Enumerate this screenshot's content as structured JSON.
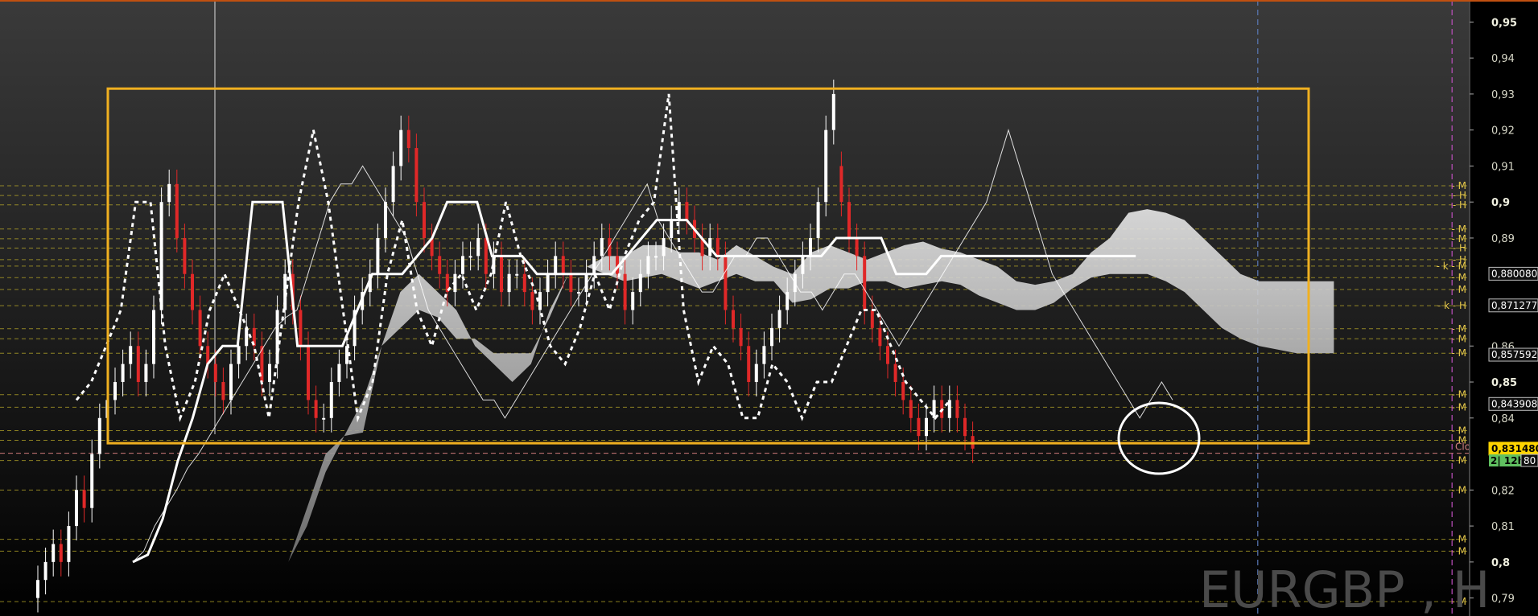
{
  "chart_data": {
    "type": "candlestick",
    "symbol_watermark": "EURGBP , H",
    "ylim": [
      0.785,
      0.955
    ],
    "y_ticks": [
      {
        "value": 0.95,
        "label": "0,95",
        "bold": true
      },
      {
        "value": 0.94,
        "label": "0,94",
        "bold": false
      },
      {
        "value": 0.93,
        "label": "0,93",
        "bold": false
      },
      {
        "value": 0.92,
        "label": "0,92",
        "bold": false
      },
      {
        "value": 0.91,
        "label": "0,91",
        "bold": false
      },
      {
        "value": 0.9,
        "label": "0,9",
        "bold": true
      },
      {
        "value": 0.89,
        "label": "0,89",
        "bold": false
      },
      {
        "value": 0.86,
        "label": "0,86",
        "bold": false
      },
      {
        "value": 0.85,
        "label": "0,85",
        "bold": true
      },
      {
        "value": 0.84,
        "label": "0,84",
        "bold": false
      },
      {
        "value": 0.82,
        "label": "0,82",
        "bold": false
      },
      {
        "value": 0.81,
        "label": "0,81",
        "bold": false
      },
      {
        "value": 0.8,
        "label": "0,8",
        "bold": true
      },
      {
        "value": 0.79,
        "label": "0,79",
        "bold": false
      }
    ],
    "price_boxes": [
      {
        "value": 0.88008,
        "label": "0,880080",
        "style": "dark"
      },
      {
        "value": 0.871277,
        "label": "0,871277",
        "style": "dark"
      },
      {
        "value": 0.857592,
        "label": "0,857592",
        "style": "dark"
      },
      {
        "value": 0.843908,
        "label": "0,843908",
        "style": "dark"
      },
      {
        "value": 0.83148,
        "label": "0,831480",
        "style": "current"
      }
    ],
    "countdown_label": "2| 12h",
    "countdown_tail": "80",
    "close_label": "Clo J",
    "level_lines": [
      {
        "value": 0.9045,
        "label": "M"
      },
      {
        "value": 0.9018,
        "label": "H"
      },
      {
        "value": 0.8992,
        "label": "H"
      },
      {
        "value": 0.8925,
        "label": "M"
      },
      {
        "value": 0.8898,
        "label": "M"
      },
      {
        "value": 0.8872,
        "label": "H"
      },
      {
        "value": 0.884,
        "label": "H"
      },
      {
        "value": 0.8822,
        "label": "k - M"
      },
      {
        "value": 0.879,
        "label": "M"
      },
      {
        "value": 0.8757,
        "label": "M"
      },
      {
        "value": 0.8712,
        "label": "k - H"
      },
      {
        "value": 0.8648,
        "label": "M"
      },
      {
        "value": 0.862,
        "label": "M"
      },
      {
        "value": 0.858,
        "label": "M"
      },
      {
        "value": 0.8465,
        "label": "M"
      },
      {
        "value": 0.843,
        "label": "M"
      },
      {
        "value": 0.8365,
        "label": "M"
      },
      {
        "value": 0.8338,
        "label": "M"
      },
      {
        "value": 0.8282,
        "label": "M"
      },
      {
        "value": 0.82,
        "label": "M"
      },
      {
        "value": 0.8063,
        "label": "M"
      },
      {
        "value": 0.803,
        "label": "M"
      },
      {
        "value": 0.789,
        "label": "M"
      }
    ],
    "range_box": {
      "top": 0.9315,
      "bottom": 0.833
    },
    "vertical_markers": [
      {
        "bar": 218,
        "color": "#5a7ab8"
      },
      {
        "bar": 252,
        "color": "#c050c0"
      },
      {
        "bar": 275,
        "color": "#c8a020"
      }
    ],
    "series": [
      {
        "name": "tenkan",
        "values": [
          0.8,
          0.803,
          0.81,
          0.815,
          0.82,
          0.826,
          0.83,
          0.835,
          0.84,
          0.845,
          0.85,
          0.855,
          0.86,
          0.865,
          0.868,
          0.87,
          0.88,
          0.89,
          0.9,
          0.905,
          0.905,
          0.91,
          0.905,
          0.9,
          0.895,
          0.89,
          0.88,
          0.87,
          0.865,
          0.86,
          0.855,
          0.85,
          0.845,
          0.845,
          0.84,
          0.845,
          0.85,
          0.855,
          0.86,
          0.865,
          0.87,
          0.875,
          0.88,
          0.885,
          0.89,
          0.895,
          0.9,
          0.905,
          0.895,
          0.89,
          0.885,
          0.88,
          0.875,
          0.875,
          0.88,
          0.885,
          0.885,
          0.89,
          0.89,
          0.885,
          0.88,
          0.875,
          0.875,
          0.87,
          0.875,
          0.88,
          0.88,
          0.875,
          0.87,
          0.865,
          0.86,
          0.865,
          0.87,
          0.875,
          0.88,
          0.885,
          0.89,
          0.895,
          0.9,
          0.91,
          0.92,
          0.91,
          0.9,
          0.89,
          0.88,
          0.875,
          0.87,
          0.865,
          0.86,
          0.855,
          0.85,
          0.845,
          0.84,
          0.845,
          0.85,
          0.845
        ]
      },
      {
        "name": "kijun",
        "values": [
          0.8,
          0.802,
          0.812,
          0.828,
          0.84,
          0.855,
          0.86,
          0.86,
          0.9,
          0.9,
          0.9,
          0.86,
          0.86,
          0.86,
          0.86,
          0.87,
          0.88,
          0.88,
          0.88,
          0.885,
          0.89,
          0.9,
          0.9,
          0.9,
          0.885,
          0.885,
          0.885,
          0.88,
          0.88,
          0.88,
          0.88,
          0.88,
          0.88,
          0.885,
          0.89,
          0.895,
          0.895,
          0.895,
          0.89,
          0.885,
          0.885,
          0.885,
          0.885,
          0.885,
          0.885,
          0.885,
          0.885,
          0.89,
          0.89,
          0.89,
          0.89,
          0.88,
          0.88,
          0.88,
          0.885,
          0.885,
          0.885,
          0.885,
          0.885,
          0.885,
          0.885,
          0.885,
          0.885,
          0.885,
          0.885,
          0.885,
          0.885,
          0.885
        ]
      },
      {
        "name": "chikou",
        "values": [
          0.845,
          0.85,
          0.86,
          0.87,
          0.9,
          0.9,
          0.86,
          0.84,
          0.85,
          0.87,
          0.88,
          0.87,
          0.86,
          0.84,
          0.87,
          0.9,
          0.92,
          0.9,
          0.87,
          0.84,
          0.85,
          0.88,
          0.895,
          0.87,
          0.86,
          0.875,
          0.88,
          0.87,
          0.88,
          0.9,
          0.885,
          0.875,
          0.86,
          0.855,
          0.865,
          0.88,
          0.87,
          0.885,
          0.895,
          0.9,
          0.93,
          0.87,
          0.85,
          0.86,
          0.855,
          0.84,
          0.84,
          0.855,
          0.85,
          0.84,
          0.85,
          0.85,
          0.86,
          0.87,
          0.87,
          0.86,
          0.85,
          0.845,
          0.84,
          0.845
        ]
      }
    ],
    "cloud": {
      "senkou_a": [
        0.79,
        0.8,
        0.81,
        0.825,
        0.835,
        0.845,
        0.86,
        0.875,
        0.88,
        0.875,
        0.87,
        0.86,
        0.855,
        0.85,
        0.855,
        0.87,
        0.88,
        0.882,
        0.885,
        0.885,
        0.888,
        0.888,
        0.886,
        0.886,
        0.884,
        0.888,
        0.885,
        0.882,
        0.88,
        0.886,
        0.888,
        0.886,
        0.884,
        0.886,
        0.888,
        0.889,
        0.887,
        0.886,
        0.884,
        0.882,
        0.878,
        0.877,
        0.878,
        0.88,
        0.886,
        0.89,
        0.897,
        0.898,
        0.897,
        0.895,
        0.89,
        0.885,
        0.88,
        0.878,
        0.878,
        0.878,
        0.878,
        0.878
      ],
      "senkou_b": [
        0.79,
        0.8,
        0.815,
        0.83,
        0.835,
        0.836,
        0.86,
        0.865,
        0.87,
        0.868,
        0.862,
        0.862,
        0.858,
        0.858,
        0.858,
        0.868,
        0.88,
        0.882,
        0.88,
        0.878,
        0.879,
        0.88,
        0.878,
        0.876,
        0.878,
        0.88,
        0.878,
        0.878,
        0.872,
        0.873,
        0.876,
        0.876,
        0.878,
        0.878,
        0.876,
        0.877,
        0.878,
        0.877,
        0.874,
        0.872,
        0.87,
        0.87,
        0.872,
        0.876,
        0.879,
        0.88,
        0.88,
        0.88,
        0.878,
        0.875,
        0.87,
        0.865,
        0.862,
        0.86,
        0.859,
        0.858,
        0.858,
        0.858
      ]
    },
    "candles_sample": {
      "description_omitted": true,
      "open": [
        0.79,
        0.795,
        0.8,
        0.805,
        0.8,
        0.81,
        0.82,
        0.815,
        0.83,
        0.84,
        0.845,
        0.85,
        0.855,
        0.86,
        0.85,
        0.855,
        0.87,
        0.9,
        0.905,
        0.89,
        0.88,
        0.87,
        0.86,
        0.855,
        0.85,
        0.845,
        0.855,
        0.86,
        0.865,
        0.86,
        0.85,
        0.855,
        0.87,
        0.88,
        0.87,
        0.86,
        0.845,
        0.84,
        0.84,
        0.85,
        0.855,
        0.86,
        0.87,
        0.875,
        0.88,
        0.89,
        0.9,
        0.91,
        0.92,
        0.915,
        0.9,
        0.89,
        0.885,
        0.88,
        0.875,
        0.88,
        0.885,
        0.885,
        0.89,
        0.88,
        0.885,
        0.875,
        0.88,
        0.88,
        0.875,
        0.87,
        0.875,
        0.88,
        0.885,
        0.88,
        0.875,
        0.875,
        0.88,
        0.885,
        0.89,
        0.885,
        0.88,
        0.87,
        0.875,
        0.88,
        0.885,
        0.885,
        0.89,
        0.895,
        0.9,
        0.895,
        0.89,
        0.885,
        0.89,
        0.885,
        0.87,
        0.865,
        0.86,
        0.85,
        0.855,
        0.86,
        0.865,
        0.87,
        0.875,
        0.88,
        0.885,
        0.89,
        0.9,
        0.92,
        0.91,
        0.9,
        0.89,
        0.885,
        0.87,
        0.865,
        0.86,
        0.855,
        0.85,
        0.845,
        0.84,
        0.835,
        0.84,
        0.845,
        0.84,
        0.845,
        0.84,
        0.835
      ],
      "close": [
        0.795,
        0.8,
        0.805,
        0.8,
        0.81,
        0.82,
        0.815,
        0.83,
        0.84,
        0.845,
        0.85,
        0.855,
        0.86,
        0.85,
        0.855,
        0.87,
        0.9,
        0.905,
        0.89,
        0.88,
        0.87,
        0.86,
        0.855,
        0.85,
        0.845,
        0.855,
        0.86,
        0.865,
        0.86,
        0.85,
        0.855,
        0.87,
        0.88,
        0.87,
        0.86,
        0.845,
        0.84,
        0.84,
        0.85,
        0.855,
        0.86,
        0.87,
        0.875,
        0.88,
        0.89,
        0.9,
        0.91,
        0.92,
        0.915,
        0.9,
        0.89,
        0.885,
        0.88,
        0.875,
        0.88,
        0.885,
        0.885,
        0.89,
        0.88,
        0.885,
        0.875,
        0.88,
        0.88,
        0.875,
        0.87,
        0.875,
        0.88,
        0.885,
        0.88,
        0.875,
        0.875,
        0.88,
        0.885,
        0.89,
        0.885,
        0.88,
        0.87,
        0.875,
        0.88,
        0.885,
        0.885,
        0.89,
        0.895,
        0.9,
        0.895,
        0.89,
        0.885,
        0.89,
        0.885,
        0.87,
        0.865,
        0.86,
        0.85,
        0.855,
        0.86,
        0.865,
        0.87,
        0.875,
        0.88,
        0.885,
        0.89,
        0.9,
        0.92,
        0.93,
        0.9,
        0.89,
        0.885,
        0.87,
        0.865,
        0.86,
        0.855,
        0.85,
        0.845,
        0.84,
        0.835,
        0.84,
        0.845,
        0.84,
        0.845,
        0.84,
        0.835,
        0.8315
      ]
    }
  }
}
